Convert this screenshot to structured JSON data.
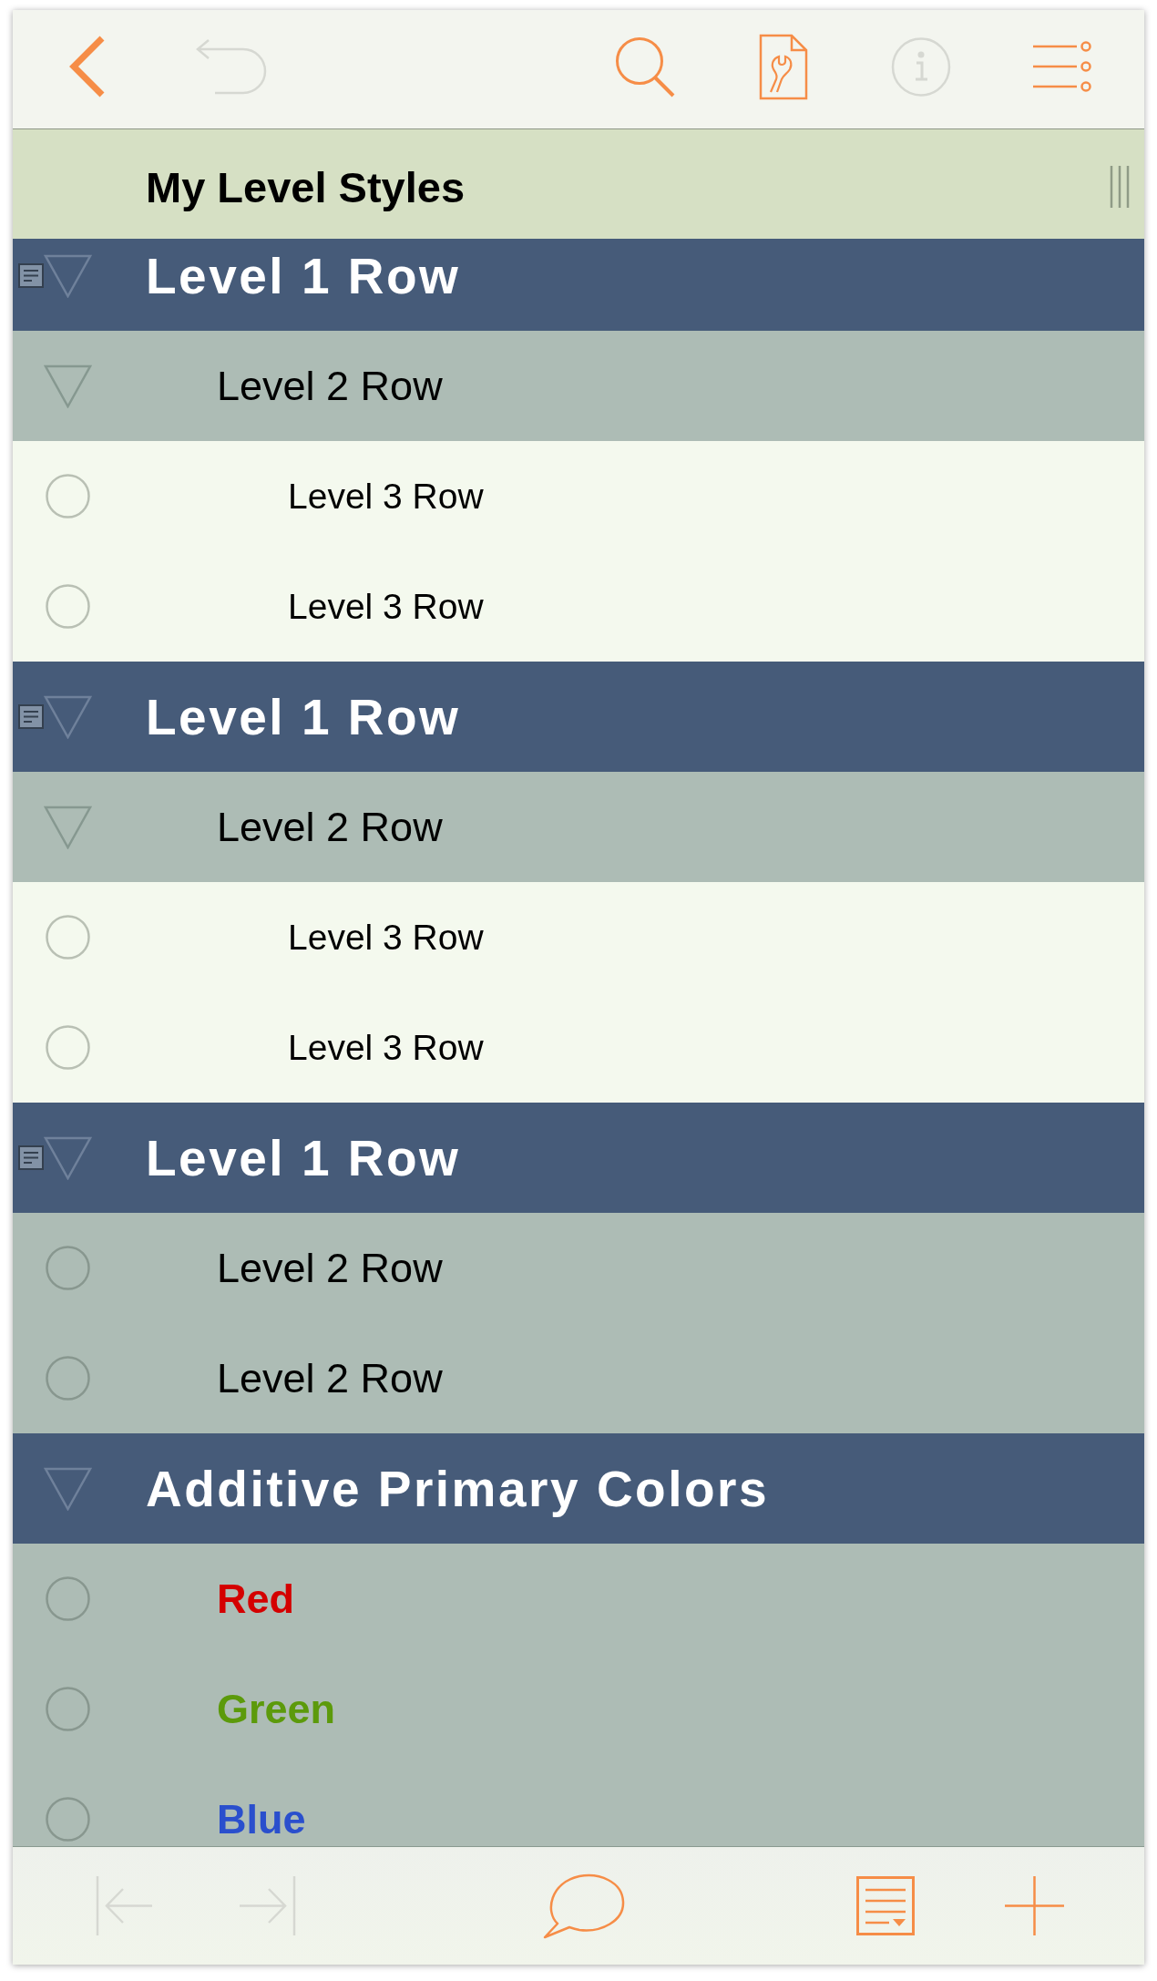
{
  "toolbar": [
    {
      "kind": "back",
      "disabled": false
    },
    {
      "kind": "undo",
      "disabled": true
    },
    {
      "kind": "search",
      "disabled": false
    },
    {
      "kind": "document-tools",
      "disabled": false
    },
    {
      "kind": "info",
      "disabled": true
    },
    {
      "kind": "view-options",
      "disabled": false
    }
  ],
  "outline": {
    "title": "My Level Styles",
    "rows": [
      {
        "text": "Level 1 Row",
        "note": true,
        "expanded": true,
        "children": [
          {
            "text": "Level 2 Row",
            "bold": false,
            "expanded": true,
            "children": [
              {
                "text": "Level 3 Row"
              },
              {
                "text": "Level 3 Row"
              }
            ]
          }
        ]
      },
      {
        "text": "Level 1 Row",
        "note": true,
        "expanded": true,
        "children": [
          {
            "text": "Level 2 Row",
            "bold": false,
            "expanded": true,
            "children": [
              {
                "text": "Level 3 Row"
              },
              {
                "text": "Level 3 Row"
              }
            ]
          }
        ]
      },
      {
        "text": "Level 1 Row",
        "note": true,
        "expanded": true,
        "children": [
          {
            "text": "Level 2 Row",
            "bold": false
          },
          {
            "text": "Level 2 Row",
            "bold": false
          }
        ]
      },
      {
        "text": "Additive Primary Colors",
        "note": false,
        "expanded": true,
        "children": [
          {
            "text": "Red",
            "bold": true,
            "color": "#d40000"
          },
          {
            "text": "Green",
            "bold": true,
            "color": "#5c9a0b"
          },
          {
            "text": "Blue",
            "bold": true,
            "color": "#2a4fcd"
          }
        ]
      }
    ]
  },
  "bottom_toolbar": [
    {
      "kind": "outdent",
      "disabled": true
    },
    {
      "kind": "indent",
      "disabled": true
    },
    {
      "kind": "comment",
      "disabled": false
    },
    {
      "kind": "notes",
      "disabled": false
    },
    {
      "kind": "add",
      "disabled": false
    }
  ]
}
